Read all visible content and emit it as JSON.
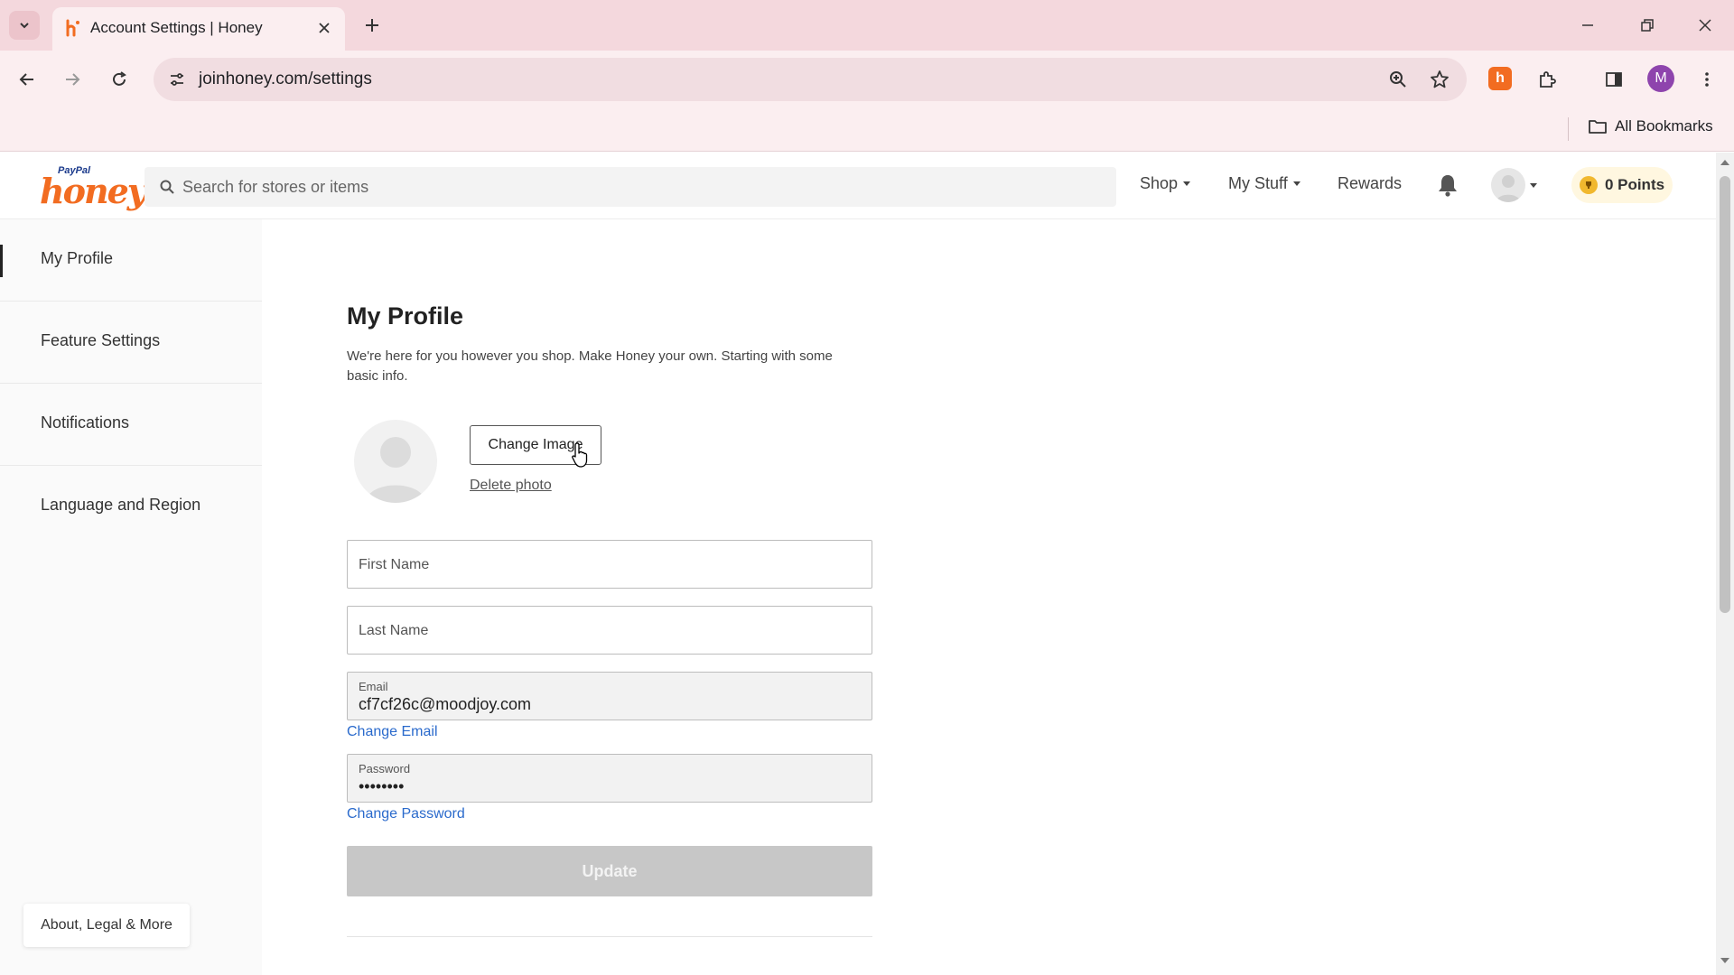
{
  "browser": {
    "tab_title": "Account Settings | Honey",
    "url": "joinhoney.com/settings",
    "profile_initial": "M",
    "bookmarks_label": "All Bookmarks"
  },
  "header": {
    "logo_small": "PayPal",
    "logo_main": "honey",
    "search_placeholder": "Search for stores or items",
    "nav": [
      "Shop",
      "My Stuff",
      "Rewards"
    ],
    "points": "0 Points"
  },
  "sidebar": {
    "items": [
      {
        "label": "My Profile",
        "active": true
      },
      {
        "label": "Feature Settings",
        "active": false
      },
      {
        "label": "Notifications",
        "active": false
      },
      {
        "label": "Language and Region",
        "active": false
      }
    ],
    "about_label": "About, Legal & More"
  },
  "main": {
    "title": "My Profile",
    "description": "We're here for you however you shop. Make Honey your own. Starting with some basic info.",
    "change_image_label": "Change Image",
    "delete_photo_label": "Delete photo",
    "first_name_placeholder": "First Name",
    "last_name_placeholder": "Last Name",
    "email_label": "Email",
    "email_value": "cf7cf26c@moodjoy.com",
    "change_email_label": "Change Email",
    "password_label": "Password",
    "password_value": "••••••••",
    "change_password_label": "Change Password",
    "update_label": "Update"
  },
  "colors": {
    "brand_orange": "#f26c21",
    "link_blue": "#2a6acc",
    "tabbar_pink": "#f4d8dd",
    "disabled_gray": "#c7c7c7"
  }
}
